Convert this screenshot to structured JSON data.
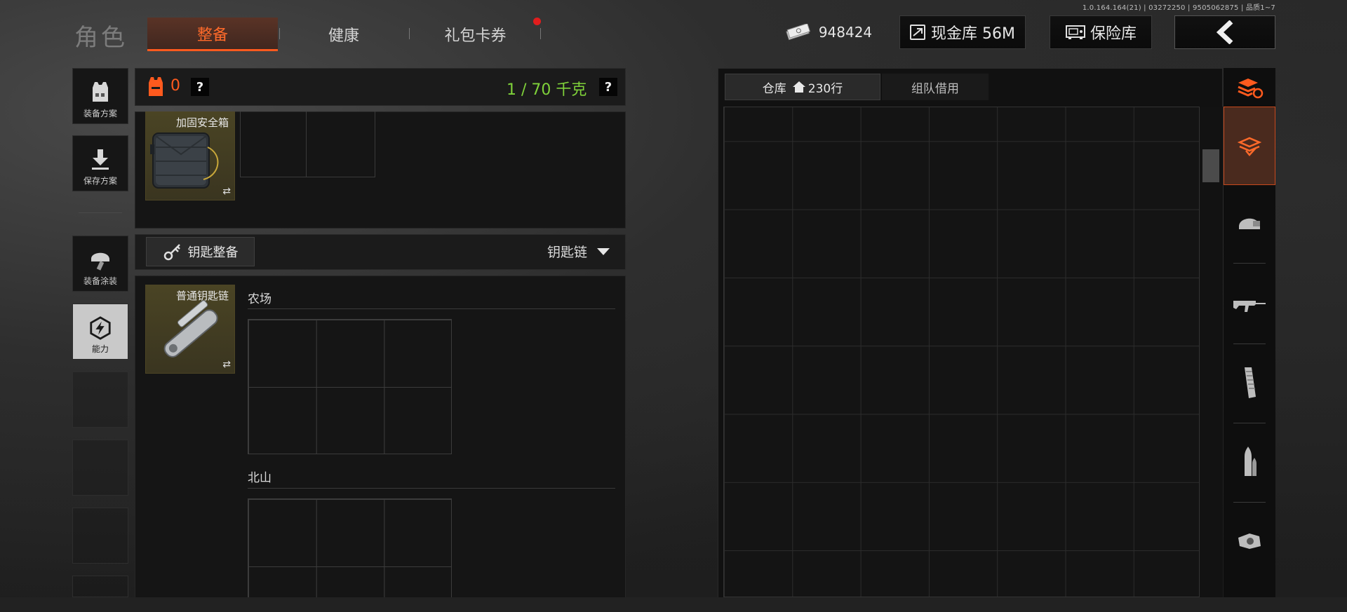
{
  "version": "1.0.164.164(21) | 03272250 | 9505062875 | 品质1~7",
  "nav": {
    "title": "角色",
    "tabs": [
      "整备",
      "健康",
      "礼包卡券"
    ]
  },
  "top": {
    "money": "948424",
    "cash_vault": "现金库 56M",
    "safe": "保险库"
  },
  "sidebar": {
    "loadout_plan": "装备方案",
    "save_plan": "保存方案",
    "skin": "装备涂装",
    "ability": "能力"
  },
  "equipment": {
    "armor_count": "0",
    "help": "?",
    "weight": "1 / 70 千克",
    "case_name": "加固安全箱",
    "swap": "⇄"
  },
  "keys": {
    "button": "钥匙整备",
    "dropdown": "钥匙链",
    "item_name": "普通钥匙链",
    "sections": [
      "农场",
      "北山"
    ]
  },
  "warehouse": {
    "tab": "仓库",
    "rows": "230行",
    "team_tab": "组队借用"
  },
  "categories": [
    "refresh-stack-icon",
    "all-items-icon",
    "helmet-icon",
    "rifle-icon",
    "magazine-icon",
    "ammo-icon",
    "scope-icon"
  ],
  "colors": {
    "accent": "#ff5a1e",
    "weight": "#7fd23a",
    "notify": "#e11d1d"
  }
}
